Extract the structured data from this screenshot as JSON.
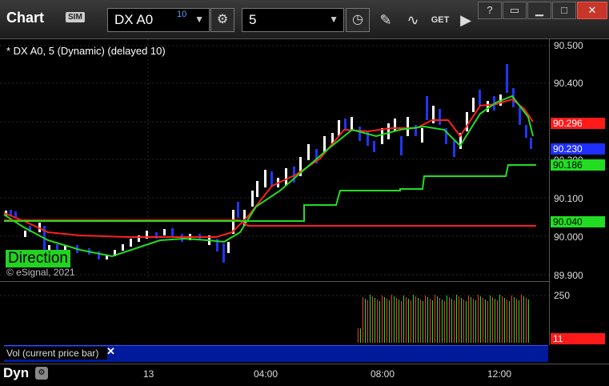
{
  "window": {
    "app_title": "Chart",
    "sim_badge": "SIM",
    "symbol": "DX A0",
    "symbol_delay": "10",
    "interval": "5",
    "controls": {
      "help": "?",
      "restore": "▭",
      "minimize": "▁",
      "maximize": "□",
      "close": "✕"
    }
  },
  "chart": {
    "label": "* DX A0, 5 (Dynamic) (delayed 10)",
    "direction_label": "Direction",
    "copyright": "© eSignal, 2021",
    "colors": {
      "up_candle": "#ffffff",
      "down_candle": "#1f36ff",
      "ma_red": "#ff2020",
      "ma_green": "#22dd22"
    }
  },
  "price_axis": {
    "ticks": [
      "90.500",
      "90.400",
      "90.300",
      "90.200",
      "90.100",
      "90.000",
      "89.900"
    ],
    "tags": [
      {
        "label": "90.296",
        "bg": "#ff1a1a",
        "fg": "#ffffff"
      },
      {
        "label": "90.230",
        "bg": "#1f2fff",
        "fg": "#ffffff"
      },
      {
        "label": "90.186",
        "bg": "#22dd22",
        "fg": "#000000"
      },
      {
        "label": "90.040",
        "bg": "#22dd22",
        "fg": "#000000"
      }
    ]
  },
  "volume": {
    "label": "Vol (current price bar)",
    "close": "✕",
    "tick": "250",
    "current_tag": "11"
  },
  "time_axis": {
    "labels": [
      "13",
      "04:00",
      "08:00",
      "12:00"
    ],
    "dyn_label": "Dyn"
  }
}
